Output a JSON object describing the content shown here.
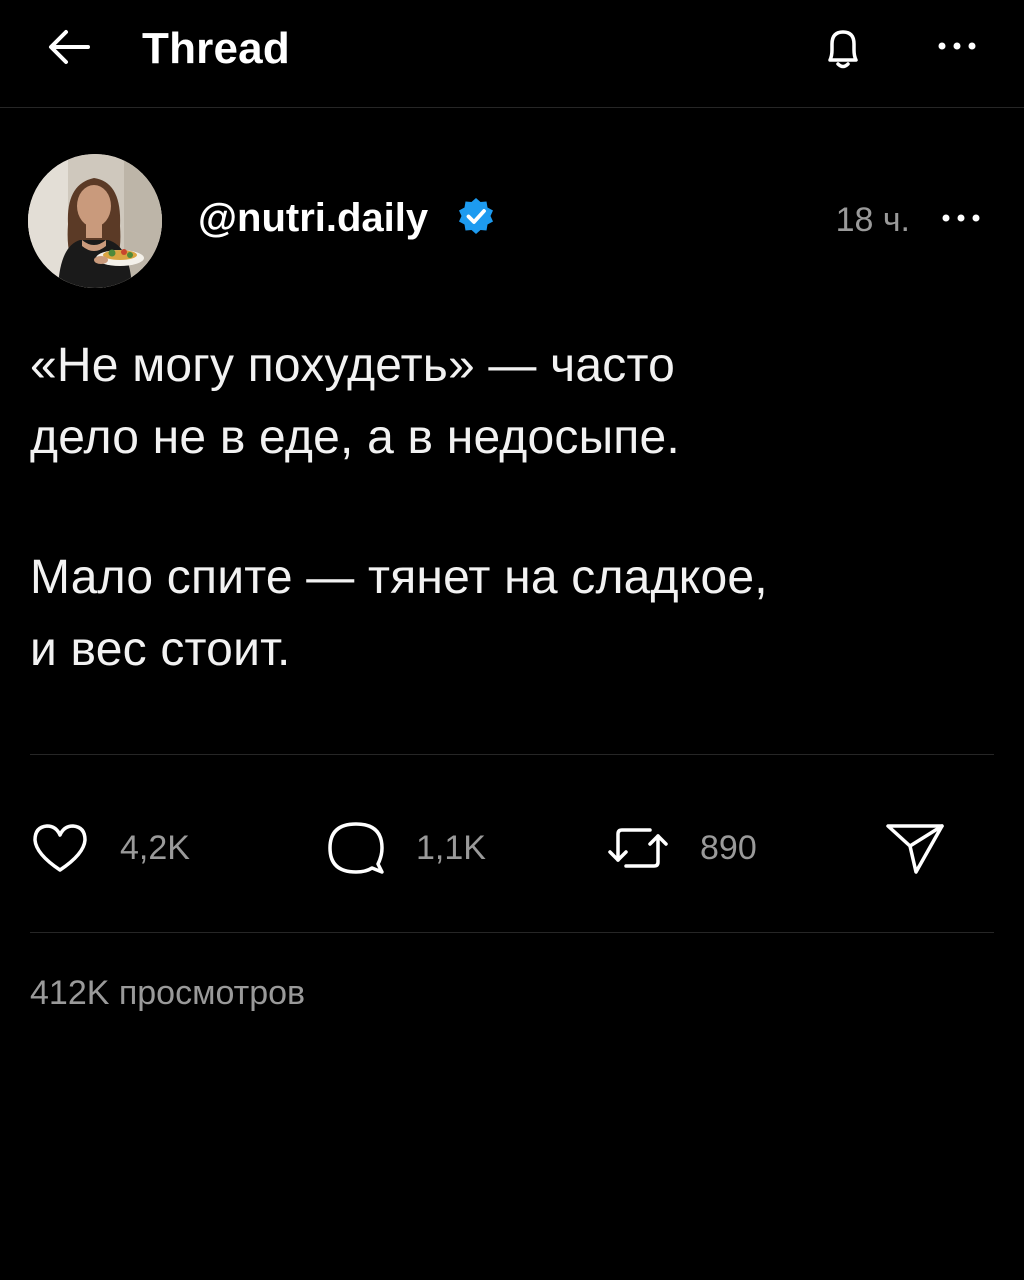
{
  "header": {
    "title": "Thread",
    "back_icon": "arrow-left-icon",
    "bell_icon": "bell-icon",
    "more_icon": "more-horizontal-icon"
  },
  "post": {
    "username": "@nutri.daily",
    "verified": true,
    "timestamp": "18 ч.",
    "paragraphs": [
      "«Не могу похудеть» — часто\nдело не в еде, а в недосыпе.",
      "Мало спите — тянет на сладкое,\nи вес стоит."
    ],
    "actions": {
      "likes": "4,2K",
      "replies": "1,1K",
      "reposts": "890"
    },
    "views": "412K просмотров"
  },
  "colors": {
    "background": "#000000",
    "text": "#ffffff",
    "muted": "#9a9a9a",
    "divider": "#262626",
    "verified": "#1d9bf0"
  }
}
